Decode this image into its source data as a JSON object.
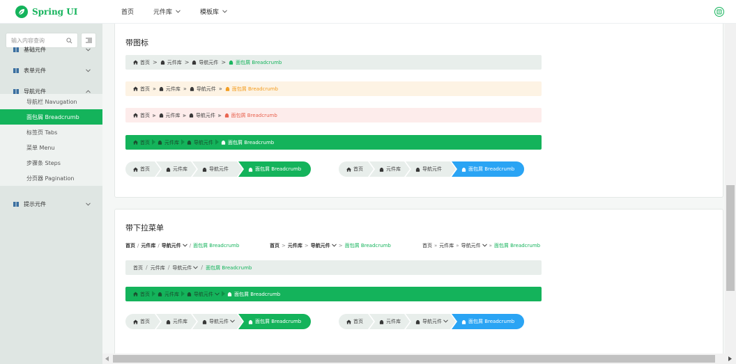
{
  "app": {
    "name": "Spring UI"
  },
  "topnav": [
    {
      "label": "首页",
      "dropdown": false
    },
    {
      "label": "元件库",
      "dropdown": true
    },
    {
      "label": "模板库",
      "dropdown": true
    }
  ],
  "sidebar": {
    "search_placeholder": "输入内容查询",
    "groups": [
      {
        "label": "基础元件",
        "expanded": false
      },
      {
        "label": "表单元件",
        "expanded": false
      },
      {
        "label": "导航元件",
        "expanded": true
      },
      {
        "label": "提示元件",
        "expanded": false
      }
    ],
    "sub_items": [
      {
        "label": "导航栏 Navugation",
        "active": false
      },
      {
        "label": "面包屑 Breadcrumb",
        "active": true
      },
      {
        "label": "标签页 Tabs",
        "active": false
      },
      {
        "label": "菜单 Menu",
        "active": false
      },
      {
        "label": "步骤条 Steps",
        "active": false
      },
      {
        "label": "分页器 Pagination",
        "active": false
      }
    ]
  },
  "colors": {
    "green": "#14b35b",
    "blue": "#2aa4f4",
    "orange": "#f39b1c",
    "red": "#e8604c"
  },
  "card1": {
    "title": "带图标",
    "crumbs": [
      "首页",
      "元件库",
      "导航元件",
      "面包屑 Breadcrumb"
    ],
    "separators": [
      ">",
      "»",
      "⫸"
    ]
  },
  "card2": {
    "title": "带下拉菜单",
    "crumbs": [
      "首页",
      "元件库",
      "导航元件",
      "面包屑 Breadcrumb"
    ]
  }
}
